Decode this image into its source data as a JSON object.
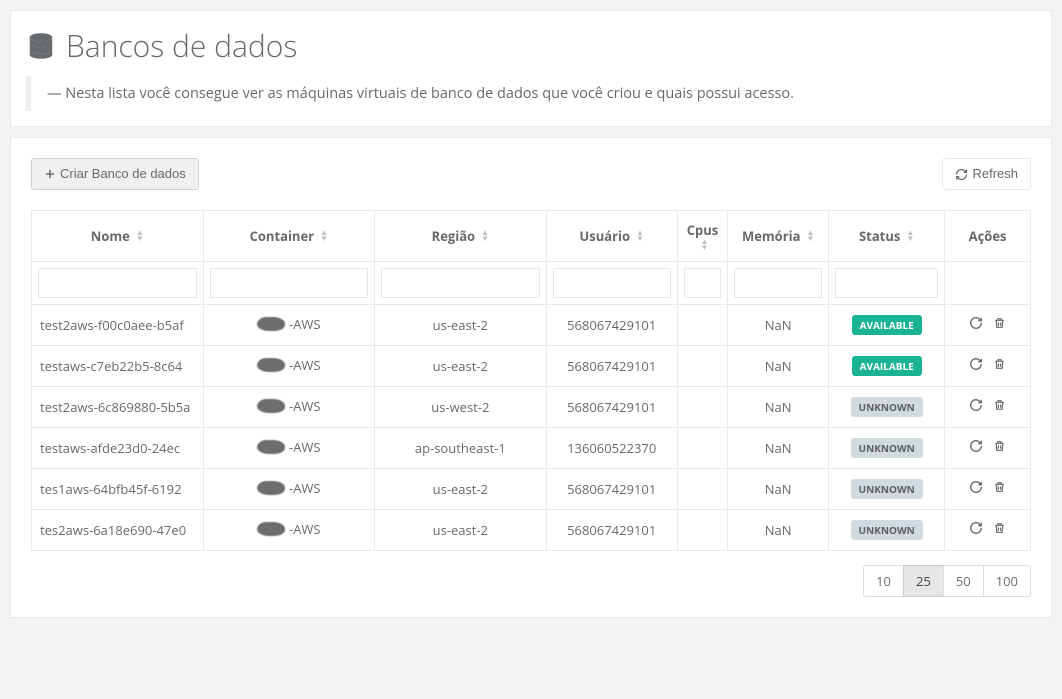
{
  "page": {
    "title": "Bancos de dados",
    "subtitle": "Nesta lista você consegue ver as máquinas virtuais de banco de dados que você criou e quais possui acesso."
  },
  "toolbar": {
    "create_label": "Criar Banco de dados",
    "refresh_label": "Refresh"
  },
  "columns": {
    "name": "Nome",
    "container": "Container",
    "region": "Região",
    "user": "Usuário",
    "cpus": "Cpus",
    "memory": "Memória",
    "status": "Status",
    "actions": "Ações"
  },
  "status_labels": {
    "AVAILABLE": "AVAILABLE",
    "UNKNOWN": "UNKNOWN"
  },
  "rows": [
    {
      "name": "test2aws-f00c0aee-b5af",
      "container": "-AWS",
      "region": "us-east-2",
      "user": "568067429101",
      "cpus": "",
      "memory": "NaN",
      "status": "AVAILABLE"
    },
    {
      "name": "testaws-c7eb22b5-8c64",
      "container": "-AWS",
      "region": "us-east-2",
      "user": "568067429101",
      "cpus": "",
      "memory": "NaN",
      "status": "AVAILABLE"
    },
    {
      "name": "test2aws-6c869880-5b5a",
      "container": "-AWS",
      "region": "us-west-2",
      "user": "568067429101",
      "cpus": "",
      "memory": "NaN",
      "status": "UNKNOWN"
    },
    {
      "name": "testaws-afde23d0-24ec",
      "container": "-AWS",
      "region": "ap-southeast-1",
      "user": "136060522370",
      "cpus": "",
      "memory": "NaN",
      "status": "UNKNOWN"
    },
    {
      "name": "tes1aws-64bfb45f-6192",
      "container": "-AWS",
      "region": "us-east-2",
      "user": "568067429101",
      "cpus": "",
      "memory": "NaN",
      "status": "UNKNOWN"
    },
    {
      "name": "tes2aws-6a18e690-47e0",
      "container": "-AWS",
      "region": "us-east-2",
      "user": "568067429101",
      "cpus": "",
      "memory": "NaN",
      "status": "UNKNOWN"
    }
  ],
  "pagination": {
    "sizes": [
      "10",
      "25",
      "50",
      "100"
    ],
    "active": "25"
  }
}
